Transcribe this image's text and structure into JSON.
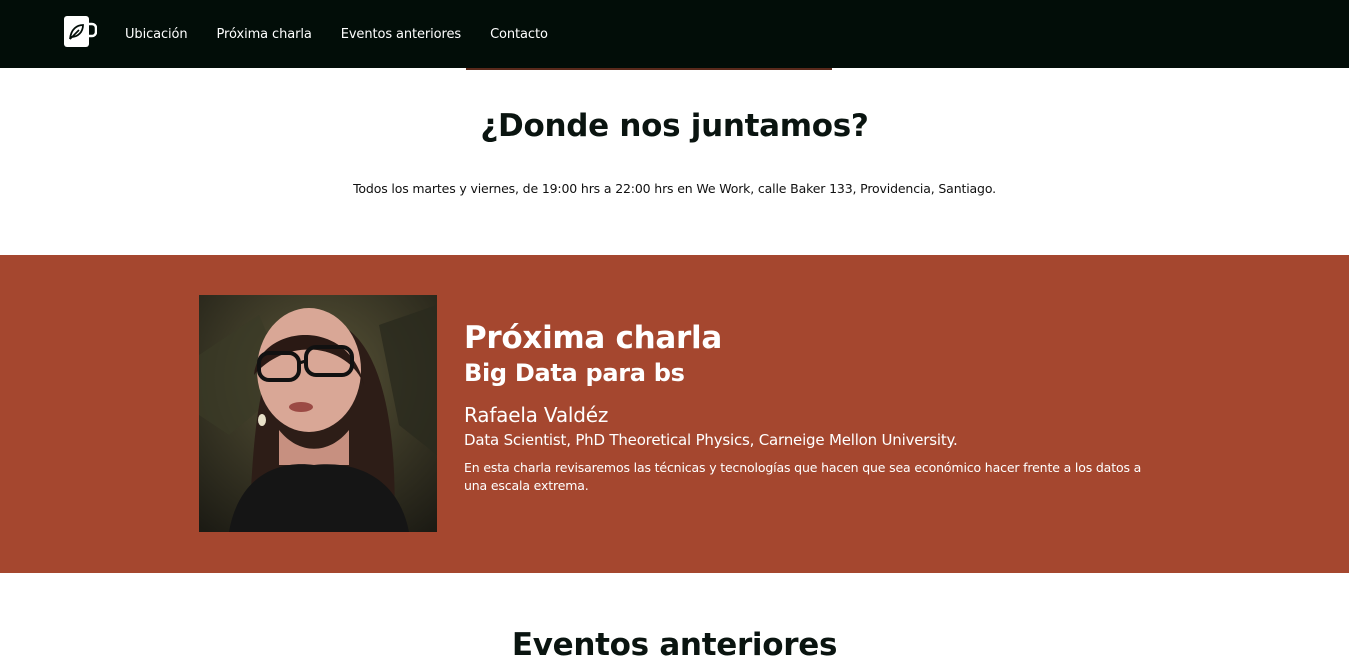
{
  "nav": {
    "links": [
      "Ubicación",
      "Próxima charla",
      "Eventos anteriores",
      "Contacto"
    ],
    "logo_icon": "coffee-mug-leaf-icon"
  },
  "location": {
    "title": "¿Donde nos juntamos?",
    "text": "Todos los martes y viernes, de 19:00 hrs a 22:00 hrs en We Work, calle Baker 133, Providencia, Santiago."
  },
  "talk": {
    "heading": "Próxima charla",
    "title": "Big Data para bs",
    "speaker_name": "Rafaela Valdéz",
    "speaker_role": "Data Scientist, PhD Theoretical Physics, Carneige Mellon University.",
    "description": "En esta charla revisaremos las técnicas y tecnologías que hacen que sea económico hacer frente a los datos a una escala extrema."
  },
  "past_events": {
    "title": "Eventos anteriores"
  },
  "colors": {
    "navbar": "#020d08",
    "talk_background": "#a5472f",
    "text_dark": "#0a1410",
    "text_light": "#ffffff"
  }
}
